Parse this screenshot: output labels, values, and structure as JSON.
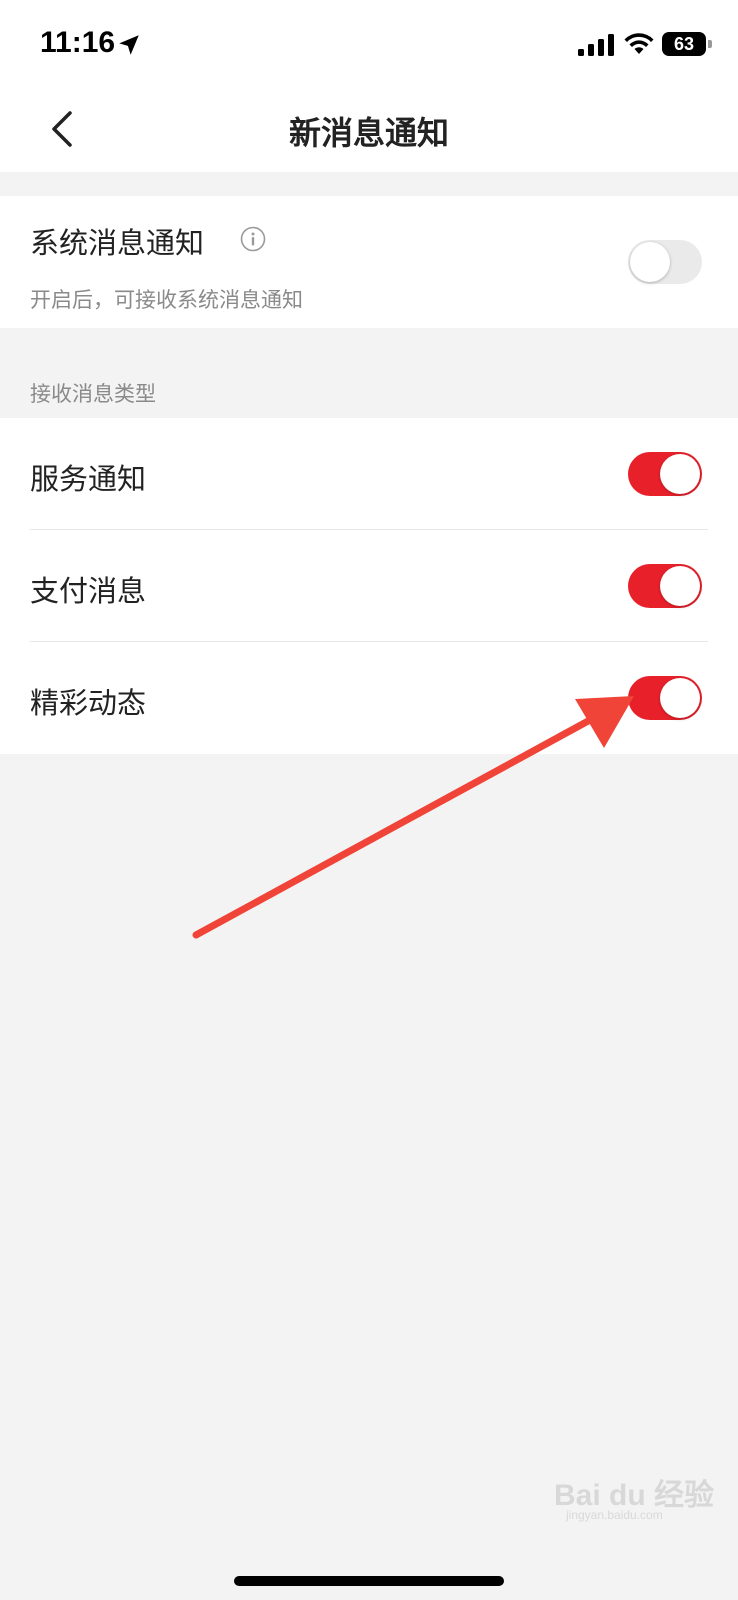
{
  "status_bar": {
    "time": "11:16",
    "battery": "63",
    "icons": [
      "location-arrow-icon",
      "signal-icon",
      "wifi-icon",
      "battery-icon"
    ]
  },
  "nav": {
    "title": "新消息通知",
    "back_icon": "chevron-left-icon"
  },
  "system_notice": {
    "title": "系统消息通知",
    "subtitle": "开启后，可接收系统消息通知",
    "info_icon": "info-icon",
    "enabled": false
  },
  "section_label": "接收消息类型",
  "message_types": [
    {
      "label": "服务通知",
      "enabled": true
    },
    {
      "label": "支付消息",
      "enabled": true
    },
    {
      "label": "精彩动态",
      "enabled": true
    }
  ],
  "colors": {
    "accent": "#e8202a",
    "toggle_off": "#eaeaea",
    "annotation_arrow": "#f04438"
  },
  "watermark": {
    "brand": "Bai du 经验",
    "url": "jingyan.baidu.com"
  }
}
